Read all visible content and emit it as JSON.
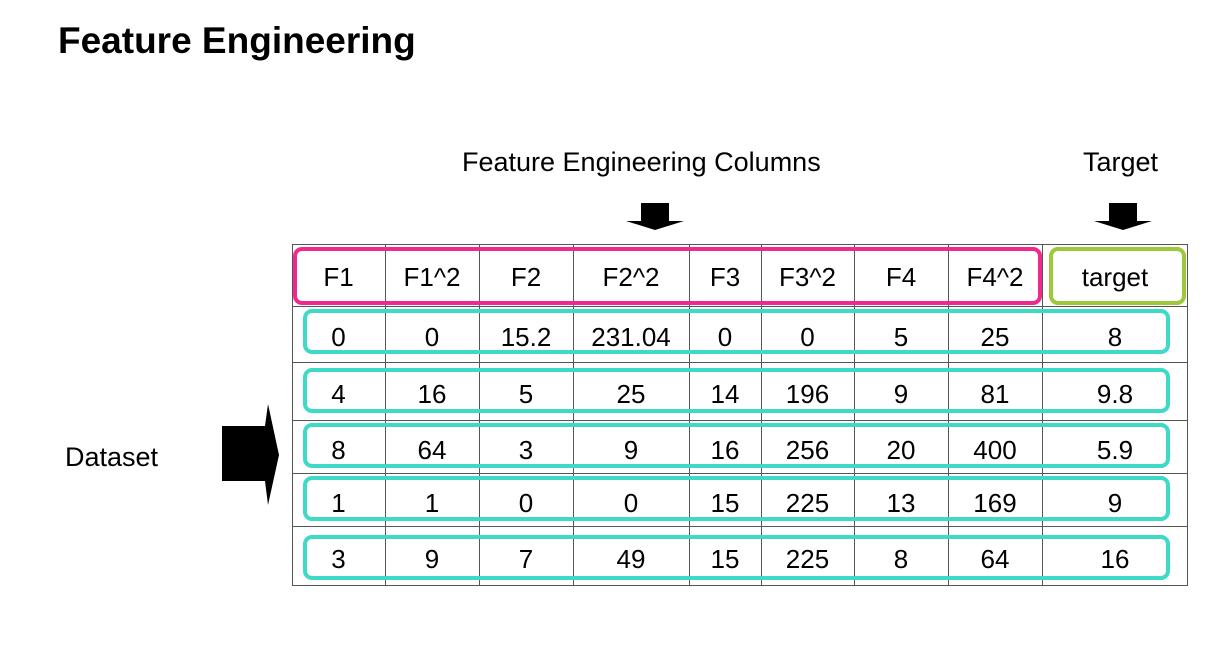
{
  "title": "Feature Engineering",
  "captions": {
    "features": "Feature Engineering Columns",
    "target": "Target",
    "dataset": "Dataset"
  },
  "table": {
    "headers": [
      "F1",
      "F1^2",
      "F2",
      "F2^2",
      "F3",
      "F3^2",
      "F4",
      "F4^2",
      "target"
    ],
    "rows": [
      [
        "0",
        "0",
        "15.2",
        "231.04",
        "0",
        "0",
        "5",
        "25",
        "8"
      ],
      [
        "4",
        "16",
        "5",
        "25",
        "14",
        "196",
        "9",
        "81",
        "9.8"
      ],
      [
        "8",
        "64",
        "3",
        "9",
        "16",
        "256",
        "20",
        "400",
        "5.9"
      ],
      [
        "1",
        "1",
        "0",
        "0",
        "15",
        "225",
        "13",
        "169",
        "9"
      ],
      [
        "3",
        "9",
        "7",
        "49",
        "15",
        "225",
        "8",
        "64",
        "16"
      ]
    ]
  },
  "colors": {
    "feature_outline": "#ee2a8f",
    "target_outline": "#9dc83a",
    "row_outline": "#3fd9c7",
    "grid": "#555555",
    "arrow": "#000000"
  }
}
